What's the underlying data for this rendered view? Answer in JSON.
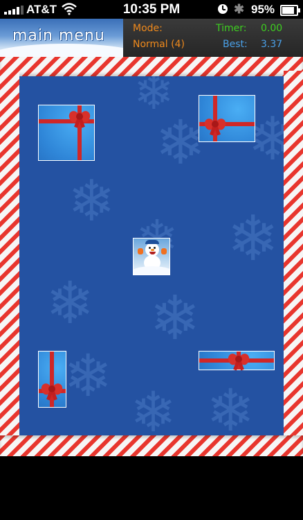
{
  "status_bar": {
    "carrier": "AT&T",
    "time": "10:35 PM",
    "battery_percent": "95%",
    "battery_level": 0.95,
    "icons": [
      "signal-bars-icon",
      "wifi-icon",
      "alarm-clock-icon",
      "bluetooth-icon",
      "battery-icon"
    ]
  },
  "header": {
    "menu_button_label": "main menu",
    "mode_label": "Mode:",
    "mode_value": "Normal (4)",
    "timer_label": "Timer:",
    "timer_value": "0.00",
    "best_label": "Best:",
    "best_value": "3.37"
  },
  "game": {
    "player": "snowman-tile",
    "gifts": [
      "gift-box",
      "gift-box",
      "gift-box",
      "gift-box"
    ],
    "colors": {
      "field": "#2452a2",
      "cane_red": "#e8362e",
      "gift_blue": "#3a9be8",
      "ribbon": "#cf2727",
      "mode_text": "#f08a1c",
      "timer_text": "#3ed020",
      "best_text": "#4aa0e8"
    }
  }
}
